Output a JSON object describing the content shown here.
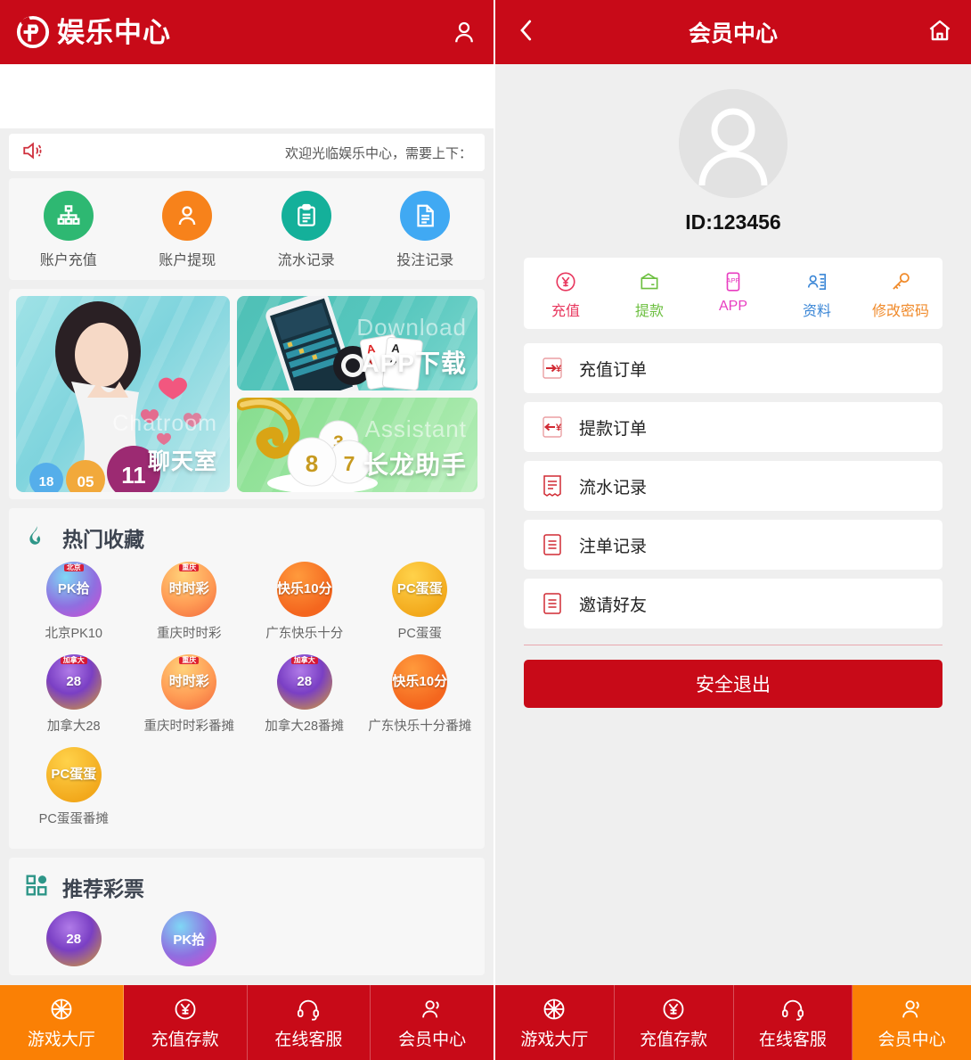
{
  "left": {
    "header": {
      "brand": "娱乐中心",
      "logo_icon": "circle-logo-icon",
      "user_icon": "user-icon"
    },
    "notice": {
      "speaker_icon": "speaker-icon",
      "text": "欢迎光临娱乐中心，需要上下："
    },
    "quick_actions": [
      {
        "label": "账户充值",
        "icon": "sitemap-icon",
        "color": "#2eb872"
      },
      {
        "label": "账户提现",
        "icon": "user-icon",
        "color": "#f7821b"
      },
      {
        "label": "流水记录",
        "icon": "clipboard-icon",
        "color": "#14b09a"
      },
      {
        "label": "投注记录",
        "icon": "document-icon",
        "color": "#40a9f3"
      }
    ],
    "banners": [
      {
        "title": "聊天室",
        "watermark": "Chatroom",
        "name": "chatroom-banner"
      },
      {
        "title": "APP下载",
        "watermark": "Download",
        "name": "app-download-banner"
      },
      {
        "title": "长龙助手",
        "watermark": "Assistant",
        "name": "assistant-banner"
      }
    ],
    "hot_section": {
      "title": "热门收藏",
      "icon": "flame-icon",
      "icon_color": "#2e9688",
      "games": [
        {
          "name": "北京PK10",
          "badge": "北京",
          "main": "PK拾",
          "style": "ico-pk10"
        },
        {
          "name": "重庆时时彩",
          "badge": "重庆",
          "main": "时时彩",
          "style": "ico-ssc"
        },
        {
          "name": "广东快乐十分",
          "badge": "",
          "main": "快乐10分",
          "style": "ico-kl10"
        },
        {
          "name": "PC蛋蛋",
          "badge": "",
          "main": "PC蛋蛋",
          "style": "ico-pcdd"
        },
        {
          "name": "加拿大28",
          "badge": "加拿大",
          "main": "28",
          "style": "ico-ca28"
        },
        {
          "name": "重庆时时彩番摊",
          "badge": "重庆",
          "main": "时时彩",
          "style": "ico-ssc"
        },
        {
          "name": "加拿大28番摊",
          "badge": "加拿大",
          "main": "28",
          "style": "ico-ca28"
        },
        {
          "name": "广东快乐十分番摊",
          "badge": "",
          "main": "快乐10分",
          "style": "ico-kl10"
        },
        {
          "name": "PC蛋蛋番摊",
          "badge": "",
          "main": "PC蛋蛋",
          "style": "ico-pcdd"
        }
      ]
    },
    "recommend_section": {
      "title": "推荐彩票",
      "icon": "grid-icon",
      "icon_color": "#2e9688",
      "games": [
        {
          "main": "28",
          "style": "ico-ca28"
        },
        {
          "main": "PK拾",
          "style": "ico-pk10"
        }
      ]
    },
    "bottom_nav": [
      {
        "label": "游戏大厅",
        "icon": "wheel-icon",
        "active": true
      },
      {
        "label": "充值存款",
        "icon": "yen-circle-icon",
        "active": false
      },
      {
        "label": "在线客服",
        "icon": "headset-icon",
        "active": false
      },
      {
        "label": "会员中心",
        "icon": "members-icon",
        "active": false
      }
    ]
  },
  "right": {
    "header": {
      "title": "会员中心",
      "back_icon": "chevron-left-icon",
      "home_icon": "home-icon"
    },
    "profile": {
      "avatar_icon": "avatar-placeholder-icon",
      "id": "ID:123456"
    },
    "actions": [
      {
        "label": "充值",
        "icon": "yen-circle-icon",
        "color": "#e8365d"
      },
      {
        "label": "提款",
        "icon": "wallet-icon",
        "color": "#6cbf3f"
      },
      {
        "label": "APP",
        "icon": "app-icon",
        "color": "#e83cc0"
      },
      {
        "label": "资料",
        "icon": "id-card-icon",
        "color": "#3a86d6"
      },
      {
        "label": "修改密码",
        "icon": "key-icon",
        "color": "#f08a2a"
      }
    ],
    "menu": [
      {
        "label": "充值订单",
        "icon": "deposit-order-icon"
      },
      {
        "label": "提款订单",
        "icon": "withdraw-order-icon"
      },
      {
        "label": "流水记录",
        "icon": "receipt-icon"
      },
      {
        "label": "注单记录",
        "icon": "bet-record-icon"
      },
      {
        "label": "邀请好友",
        "icon": "invite-friend-icon"
      }
    ],
    "logout_label": "安全退出",
    "bottom_nav": [
      {
        "label": "游戏大厅",
        "icon": "wheel-icon",
        "active": false
      },
      {
        "label": "充值存款",
        "icon": "yen-circle-icon",
        "active": false
      },
      {
        "label": "在线客服",
        "icon": "headset-icon",
        "active": false
      },
      {
        "label": "会员中心",
        "icon": "members-icon",
        "active": true
      }
    ]
  },
  "theme": {
    "primary_red": "#c80a18",
    "active_orange": "#fa8005",
    "page_bg": "#efefef"
  }
}
